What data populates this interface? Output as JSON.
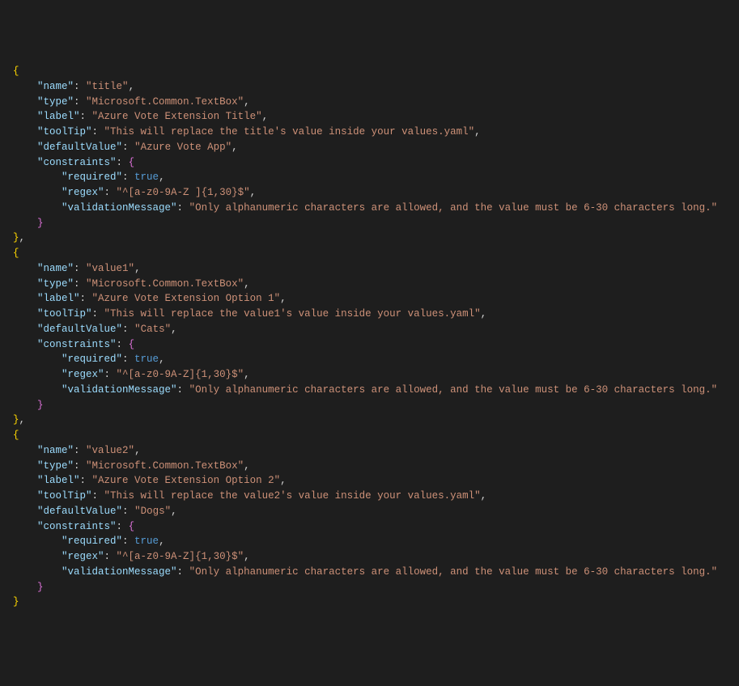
{
  "entries": [
    {
      "name_key": "\"name\"",
      "name_val": "\"title\"",
      "type_key": "\"type\"",
      "type_val": "\"Microsoft.Common.TextBox\"",
      "label_key": "\"label\"",
      "label_val": "\"Azure Vote Extension Title\"",
      "tooltip_key": "\"toolTip\"",
      "tooltip_val": "\"This will replace the title's value inside your values.yaml\"",
      "default_key": "\"defaultValue\"",
      "default_val": "\"Azure Vote App\"",
      "constraints_key": "\"constraints\"",
      "required_key": "\"required\"",
      "required_val": "true",
      "regex_key": "\"regex\"",
      "regex_val": "\"^[a-z0-9A-Z ]{1,30}$\"",
      "vmsg_key": "\"validationMessage\"",
      "vmsg_val": "\"Only alphanumeric characters are allowed, and the value must be 6-30 characters long.\""
    },
    {
      "name_key": "\"name\"",
      "name_val": "\"value1\"",
      "type_key": "\"type\"",
      "type_val": "\"Microsoft.Common.TextBox\"",
      "label_key": "\"label\"",
      "label_val": "\"Azure Vote Extension Option 1\"",
      "tooltip_key": "\"toolTip\"",
      "tooltip_val": "\"This will replace the value1's value inside your values.yaml\"",
      "default_key": "\"defaultValue\"",
      "default_val": "\"Cats\"",
      "constraints_key": "\"constraints\"",
      "required_key": "\"required\"",
      "required_val": "true",
      "regex_key": "\"regex\"",
      "regex_val": "\"^[a-z0-9A-Z]{1,30}$\"",
      "vmsg_key": "\"validationMessage\"",
      "vmsg_val": "\"Only alphanumeric characters are allowed, and the value must be 6-30 characters long.\""
    },
    {
      "name_key": "\"name\"",
      "name_val": "\"value2\"",
      "type_key": "\"type\"",
      "type_val": "\"Microsoft.Common.TextBox\"",
      "label_key": "\"label\"",
      "label_val": "\"Azure Vote Extension Option 2\"",
      "tooltip_key": "\"toolTip\"",
      "tooltip_val": "\"This will replace the value2's value inside your values.yaml\"",
      "default_key": "\"defaultValue\"",
      "default_val": "\"Dogs\"",
      "constraints_key": "\"constraints\"",
      "required_key": "\"required\"",
      "required_val": "true",
      "regex_key": "\"regex\"",
      "regex_val": "\"^[a-z0-9A-Z]{1,30}$\"",
      "vmsg_key": "\"validationMessage\"",
      "vmsg_val": "\"Only alphanumeric characters are allowed, and the value must be 6-30 characters long.\""
    }
  ]
}
